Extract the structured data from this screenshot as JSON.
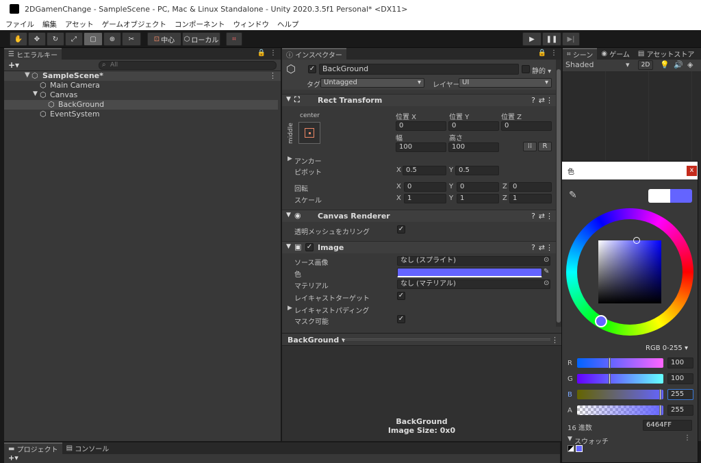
{
  "window": {
    "title": "2DGamenChange - SampleScene - PC, Mac & Linux Standalone - Unity 2020.3.5f1 Personal* <DX11>"
  },
  "menu": [
    "ファイル",
    "編集",
    "アセット",
    "ゲームオブジェクト",
    "コンポーネント",
    "ウィンドウ",
    "ヘルプ"
  ],
  "toolbar": {
    "pivot_label": "中心",
    "space_label": "ローカル"
  },
  "hierarchy": {
    "tab": "ヒエラルキー",
    "add": "+▾",
    "search_placeholder": "All",
    "scene": "SampleScene*",
    "items": [
      "Main Camera",
      "Canvas",
      "BackGround",
      "EventSystem"
    ]
  },
  "inspector": {
    "tab": "インスペクター",
    "object_name": "BackGround",
    "static_label": "静的 ▾",
    "tag_label": "タグ",
    "tag_value": "Untagged",
    "layer_label": "レイヤー",
    "layer_value": "UI",
    "rect": {
      "title": "Rect Transform",
      "anchor_top": "center",
      "anchor_side": "middle",
      "posx_label": "位置 X",
      "posy_label": "位置 Y",
      "posz_label": "位置 Z",
      "posx": "0",
      "posy": "0",
      "posz": "0",
      "width_label": "幅",
      "height_label": "高さ",
      "width": "100",
      "height": "100",
      "r_btn": "R",
      "anchor_label": "アンカー",
      "pivot_label": "ピボット",
      "pivot_x": "0.5",
      "pivot_y": "0.5",
      "rotation_label": "回転",
      "rot_x": "0",
      "rot_y": "0",
      "rot_z": "0",
      "scale_label": "スケール",
      "scale_x": "1",
      "scale_y": "1",
      "scale_z": "1",
      "x": "X",
      "y": "Y",
      "z": "Z"
    },
    "canvas_renderer": {
      "title": "Canvas Renderer",
      "cull_label": "透明メッシュをカリング"
    },
    "image": {
      "title": "Image",
      "source_label": "ソース画像",
      "source_value": "なし (スプライト)",
      "color_label": "色",
      "color": "#6464FF",
      "material_label": "マテリアル",
      "material_value": "なし (マテリアル)",
      "raycast_label": "レイキャストターゲット",
      "padding_label": "レイキャストパディング",
      "mask_label": "マスク可能"
    },
    "preview": {
      "title": "BackGround ▾",
      "name": "BackGround",
      "size": "Image Size: 0x0"
    }
  },
  "scene_view": {
    "tabs": [
      "シーン",
      "ゲーム",
      "アセットストア"
    ],
    "shading": "Shaded",
    "mode2d": "2D"
  },
  "color_picker": {
    "title": "色",
    "close": "x",
    "mode": "RGB 0-255 ▾",
    "r_label": "R",
    "r": "100",
    "g_label": "G",
    "g": "100",
    "b_label": "B",
    "b": "255",
    "a_label": "A",
    "a": "255",
    "hex_label": "16 進数",
    "hex": "6464FF",
    "swatches_label": "スウォッチ",
    "current_color": "#6464FF"
  },
  "bottom": {
    "tabs": [
      "プロジェクト",
      "コンソール"
    ],
    "add": "+▾"
  }
}
